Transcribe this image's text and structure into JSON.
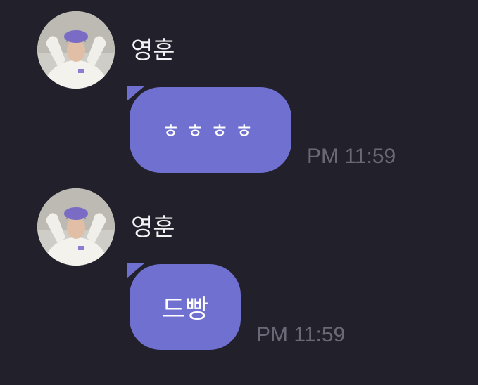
{
  "messages": [
    {
      "sender": "영훈",
      "text": "ㅎㅎㅎㅎ",
      "time": "PM 11:59"
    },
    {
      "sender": "영훈",
      "text": "드빵",
      "time": "PM 11:59"
    }
  ],
  "colors": {
    "background": "#22212b",
    "bubble": "#7070d0",
    "sender_name": "#f4f4f6",
    "timestamp": "#6a6975"
  },
  "icons": {
    "avatar": "profile-photo"
  }
}
